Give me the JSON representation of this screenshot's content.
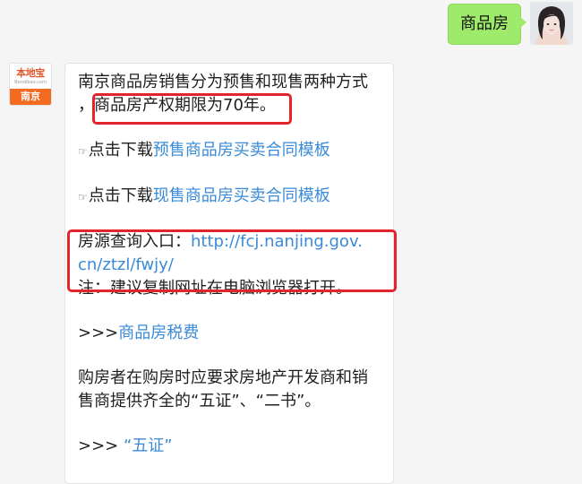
{
  "outgoing": {
    "text": "商品房",
    "avatar": "user-avatar"
  },
  "incoming": {
    "avatar": {
      "logo_text": "本地宝",
      "logo_subtext": "Bendibao.com",
      "city": "南京"
    },
    "intro_line1": "南京商品房销售分为预售和现售两种方式",
    "intro_line2_prefix": "，",
    "intro_line2_highlight": "商品房产权期限为70年。",
    "download1": {
      "icon": "hand-pointing-icon",
      "icon_glyph": "☞",
      "prefix": "点击下载",
      "link": "预售商品房买卖合同模板"
    },
    "download2": {
      "icon": "hand-pointing-icon",
      "icon_glyph": "☞",
      "prefix": "点击下载",
      "link": "现售商品房买卖合同模板"
    },
    "query": {
      "label": "房源查询入口：",
      "url_line1": "http://fcj.nanjing.gov.",
      "url_line2": "cn/ztzl/fwjy/"
    },
    "note": "注：建议复制网址在电脑浏览器打开。",
    "tax": {
      "prefix": ">>>",
      "link": "商品房税费"
    },
    "buyer_line1": "购房者在购房时应要求房地产开发商和销",
    "buyer_line2": "售商提供齐全的“五证”、“二书”。",
    "five_cert": {
      "prefix": ">>>",
      "link": "“五证”"
    }
  },
  "colors": {
    "bubble_out": "#9eea6a",
    "link": "#3a8ad7",
    "highlight_border": "#e3242b",
    "logo_orange": "#f36b21"
  }
}
